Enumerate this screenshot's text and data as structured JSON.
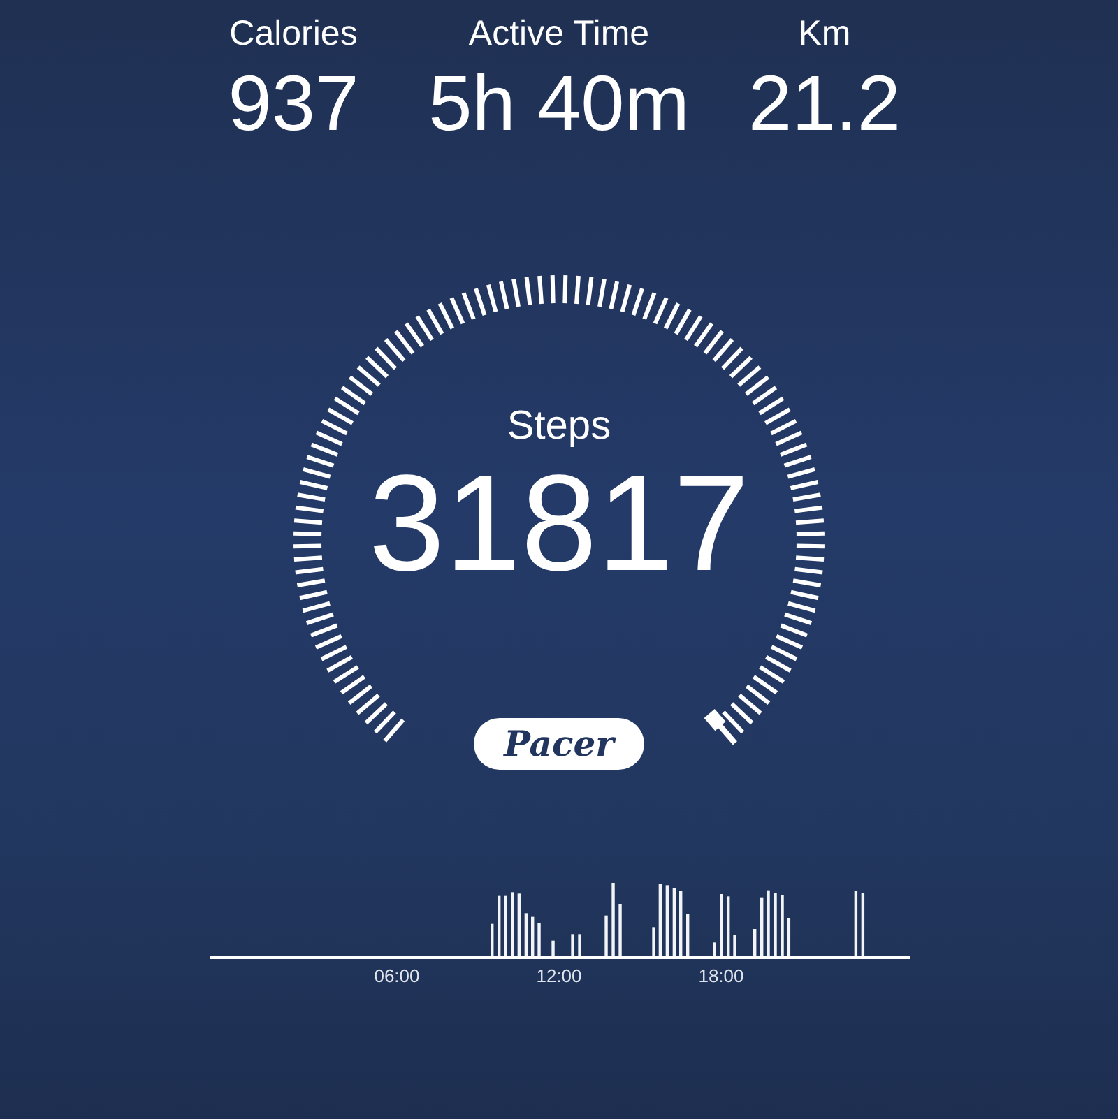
{
  "stats": [
    {
      "label": "Calories",
      "value": "937"
    },
    {
      "label": "Active Time",
      "value": "5h 40m"
    },
    {
      "label": "Km",
      "value": "21.2"
    }
  ],
  "gauge": {
    "label": "Steps",
    "value": "31817"
  },
  "brand": "Pacer",
  "activity_chart": {
    "ticks": [
      "06:00",
      "12:00",
      "18:00"
    ]
  }
}
